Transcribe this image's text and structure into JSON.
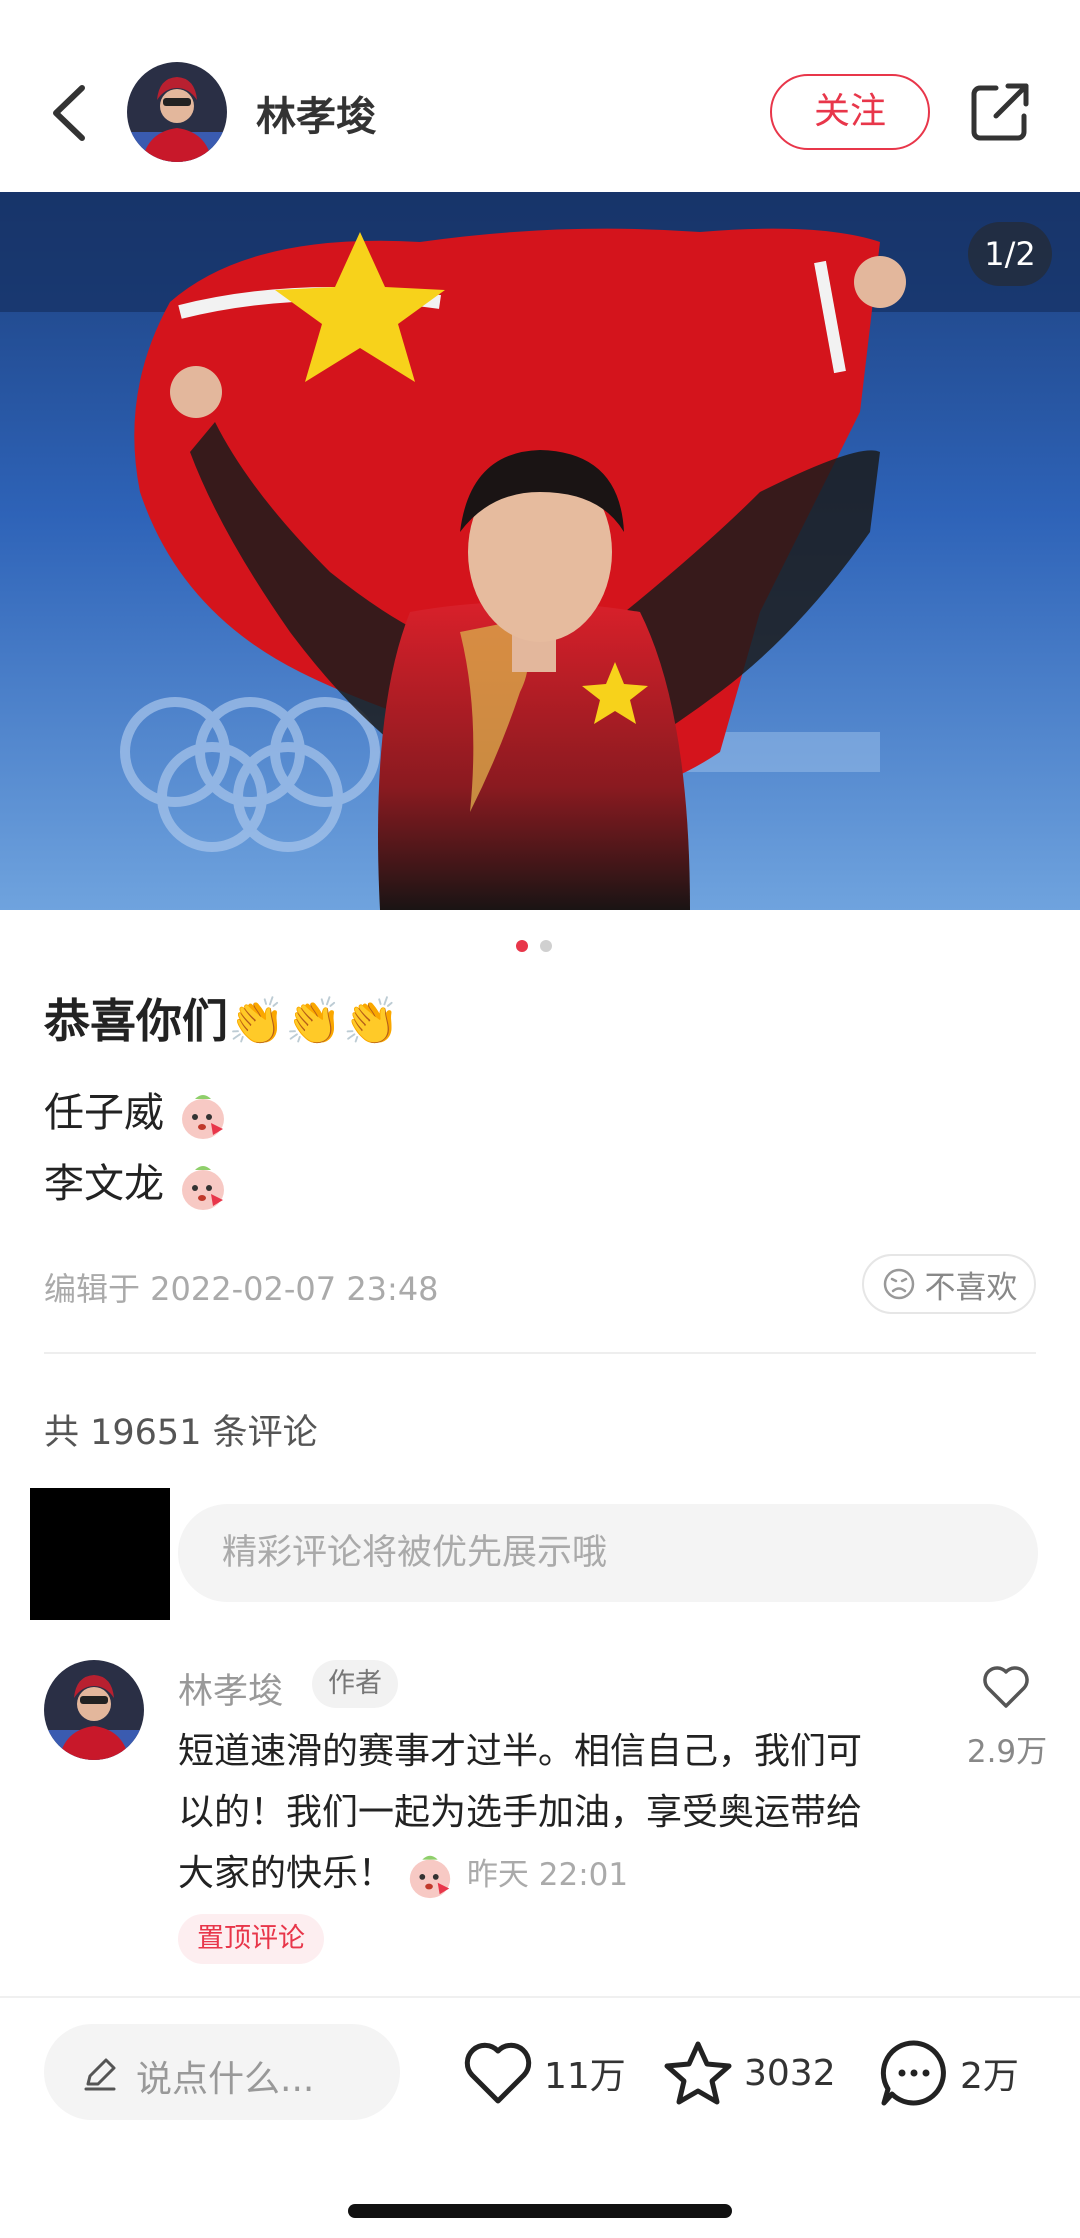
{
  "header": {
    "author_name": "林孝埈",
    "follow_label": "关注"
  },
  "photo": {
    "counter": "1/2",
    "current_index": 1,
    "total": 2
  },
  "post": {
    "title": "恭喜你们👏👏👏",
    "lines": [
      "任子威",
      "李文龙"
    ],
    "edit_time": "编辑于 2022-02-07 23:48",
    "dislike_label": "不喜欢"
  },
  "comments_section": {
    "count_text": "共 19651 条评论",
    "input_placeholder": "精彩评论将被优先展示哦",
    "pinned_comment": {
      "author": "林孝埈",
      "author_tag": "作者",
      "text_line1": "短道速滑的赛事才过半。相信自己，我们可",
      "text_line2": "以的！我们一起为选手加油，享受奥运带给",
      "text_line3": "大家的快乐！",
      "time": "昨天 22:01",
      "likes": "2.9万",
      "pin_label": "置顶评论"
    }
  },
  "bottom_bar": {
    "input_placeholder": "说点什么...",
    "likes": "11万",
    "favorites": "3032",
    "comments": "2万"
  },
  "colors": {
    "accent": "#e8364a",
    "background": "#ffffff"
  }
}
